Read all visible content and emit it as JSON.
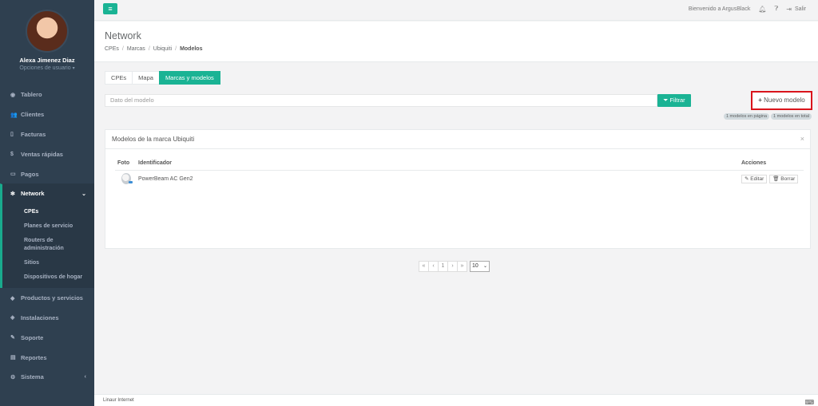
{
  "user": {
    "name": "Alexa Jimenez Diaz",
    "options_label": "Opciones de usuario"
  },
  "sidebar": {
    "items": [
      {
        "label": "Tablero",
        "icon": "dashboard-icon"
      },
      {
        "label": "Clientes",
        "icon": "users-icon"
      },
      {
        "label": "Facturas",
        "icon": "file-icon"
      },
      {
        "label": "Ventas rápidas",
        "icon": "dollar-icon"
      },
      {
        "label": "Pagos",
        "icon": "money-icon"
      },
      {
        "label": "Network",
        "icon": "network-icon"
      },
      {
        "label": "Productos y servicios",
        "icon": "tag-icon"
      },
      {
        "label": "Instalaciones",
        "icon": "install-icon"
      },
      {
        "label": "Soporte",
        "icon": "wrench-icon"
      },
      {
        "label": "Reportes",
        "icon": "book-icon"
      },
      {
        "label": "Sistema",
        "icon": "cogs-icon"
      }
    ],
    "network_sub": [
      "CPEs",
      "Planes de servicio",
      "Routers de administración",
      "Sitios",
      "Dispositivos de hogar"
    ]
  },
  "topbar": {
    "welcome": "Bienvenido a ArgusBlack",
    "logout": "Salir"
  },
  "page": {
    "title": "Network",
    "breadcrumb": [
      "CPEs",
      "Marcas",
      "Ubiquiti",
      "Modelos"
    ]
  },
  "tabs": [
    "CPEs",
    "Mapa",
    "Marcas y modelos"
  ],
  "search": {
    "placeholder": "Dato del modelo",
    "filter_label": "Filtrar"
  },
  "new_model_label": "Nuevo modelo",
  "counts": {
    "page": "1 modelos en página",
    "total": "1 modelos en total"
  },
  "panel": {
    "title": "Modelos de la marca Ubiquiti",
    "columns": {
      "photo": "Foto",
      "identifier": "Identificador",
      "actions": "Acciones"
    },
    "rows": [
      {
        "identifier": "PowerBeam AC Gen2"
      }
    ],
    "edit_label": "Editar",
    "delete_label": "Borrar"
  },
  "pagination": {
    "first": "«",
    "prev": "‹",
    "current": "1",
    "next": "›",
    "last": "»",
    "page_size": "10"
  },
  "footer": {
    "text": "Linaur Internet"
  },
  "colors": {
    "accent": "#1ab394",
    "sidebar": "#2f4050",
    "highlight_border": "#d9141b"
  }
}
